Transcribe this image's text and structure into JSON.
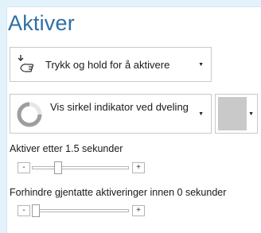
{
  "title": "Aktiver",
  "activation_mode": {
    "label": "Trykk og hold for å aktivere",
    "icon": "touch-hold-icon"
  },
  "indicator": {
    "label": "Vis sirkel indikator ved dveling",
    "icon": "circle-progress-icon"
  },
  "color_picker": {
    "color": "#c9c9c9"
  },
  "activate_after": {
    "label": "Aktiver etter 1.5 sekunder",
    "minus": "-",
    "plus": "+",
    "value_fraction": 0.25
  },
  "prevent_repeat": {
    "label": "Forhindre gjentatte aktiveringer innen 0 sekunder",
    "minus": "-",
    "plus": "+",
    "value_fraction": 0.0
  }
}
